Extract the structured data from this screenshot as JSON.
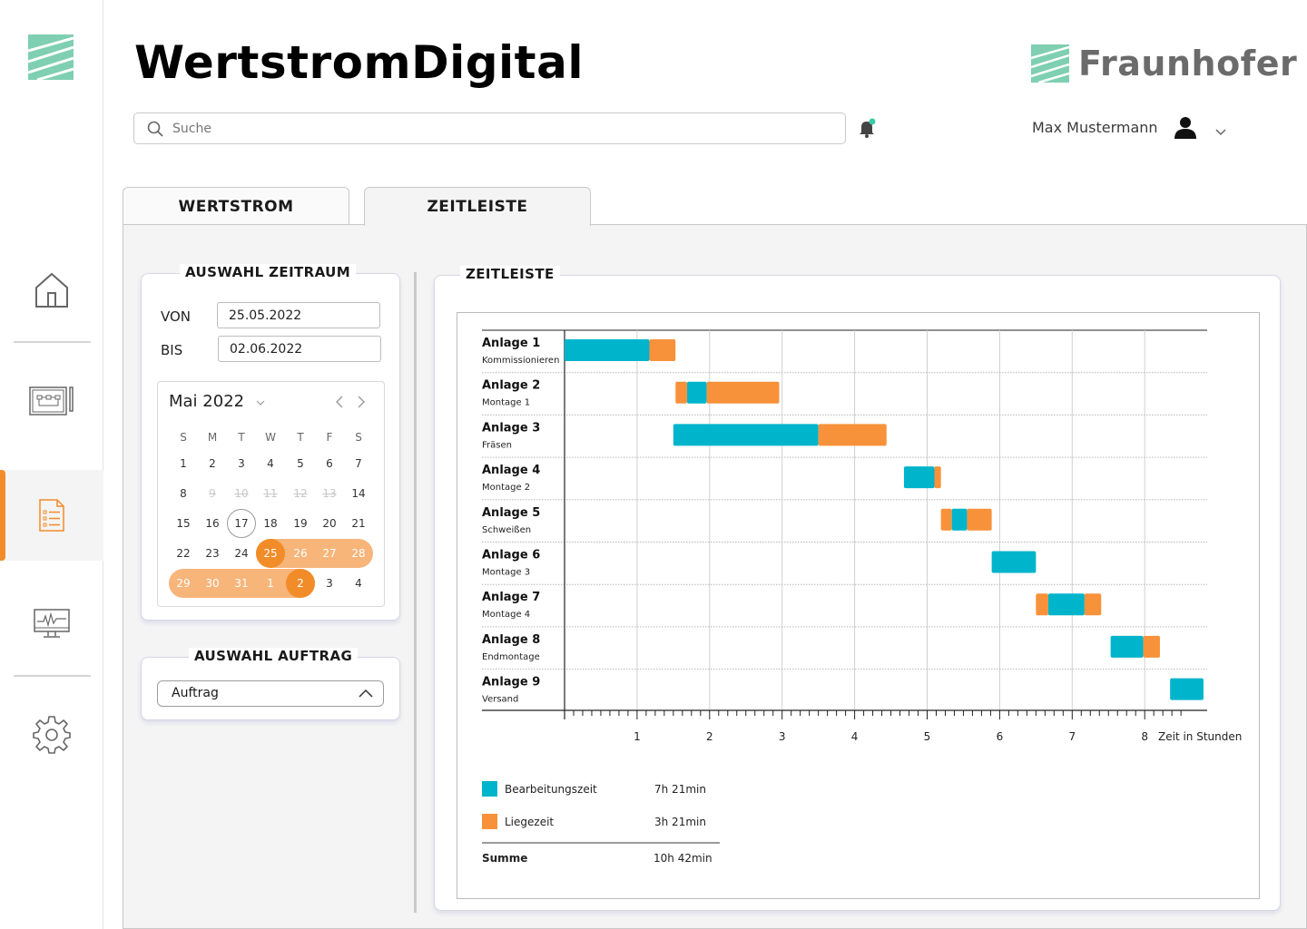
{
  "app": {
    "title": "WertstromDigital",
    "brand": "Fraunhofer"
  },
  "header": {
    "search_placeholder": "Suche",
    "username": "Max Mustermann"
  },
  "tabs": [
    {
      "label": "WERTSTROM"
    },
    {
      "label": "ZEITLEISTE"
    }
  ],
  "zeitraum": {
    "title": "AUSWAHL ZEITRAUM",
    "von_label": "VON",
    "von_value": "25.05.2022",
    "bis_label": "BIS",
    "bis_value": "02.06.2022",
    "calendar": {
      "month": "Mai 2022",
      "weekdays": [
        "S",
        "M",
        "T",
        "W",
        "T",
        "F",
        "S"
      ],
      "weeks": [
        [
          "1",
          "2",
          "3",
          "4",
          "5",
          "6",
          "7"
        ],
        [
          "8",
          "9",
          "10",
          "11",
          "12",
          "13",
          "14"
        ],
        [
          "15",
          "16",
          "17",
          "18",
          "19",
          "20",
          "21"
        ],
        [
          "22",
          "23",
          "24",
          "25",
          "26",
          "27",
          "28"
        ],
        [
          "29",
          "30",
          "31",
          "1",
          "2",
          "3",
          "4"
        ]
      ],
      "disabled": [
        "9",
        "10",
        "11",
        "12",
        "13"
      ],
      "today": "17",
      "range_start": "25",
      "range_end": "2"
    }
  },
  "auftrag": {
    "title": "AUSWAHL AUFTRAG",
    "value": "Auftrag"
  },
  "zeitleiste": {
    "title": "ZEITLEISTE",
    "summary": {
      "bearbeitung_label": "Bearbeitungszeit",
      "bearbeitung_value": "7h 21min",
      "liege_label": "Liegezeit",
      "liege_value": "3h 21min",
      "summe_label": "Summe",
      "summe_value": "10h 42min"
    }
  },
  "colors": {
    "accent": "#f28c28",
    "bearbeitung": "#00b4cc",
    "liege": "#f7923a",
    "brand_green": "#7fcfb2"
  },
  "chart_data": {
    "type": "bar",
    "orientation": "horizontal-gantt",
    "xlabel": "Zeit in Stunden",
    "xlim": [
      0,
      8.5
    ],
    "xticks": [
      1,
      2,
      3,
      4,
      5,
      6,
      7,
      8
    ],
    "grid": true,
    "rows": [
      {
        "name": "Anlage 1",
        "sub": "Kommissionieren",
        "segments": [
          {
            "type": "bearbeitung",
            "start": 0.0,
            "end": 1.17
          },
          {
            "type": "liege",
            "start": 1.17,
            "end": 1.53
          }
        ]
      },
      {
        "name": "Anlage 2",
        "sub": "Montage 1",
        "segments": [
          {
            "type": "liege",
            "start": 1.53,
            "end": 1.69
          },
          {
            "type": "bearbeitung",
            "start": 1.69,
            "end": 1.96
          },
          {
            "type": "liege",
            "start": 1.96,
            "end": 2.96
          }
        ]
      },
      {
        "name": "Anlage 3",
        "sub": "Fräsen",
        "segments": [
          {
            "type": "bearbeitung",
            "start": 1.5,
            "end": 3.5
          },
          {
            "type": "liege",
            "start": 3.5,
            "end": 4.44
          }
        ]
      },
      {
        "name": "Anlage 4",
        "sub": "Montage 2",
        "segments": [
          {
            "type": "bearbeitung",
            "start": 4.68,
            "end": 5.1
          },
          {
            "type": "liege",
            "start": 5.1,
            "end": 5.19
          }
        ]
      },
      {
        "name": "Anlage 5",
        "sub": "Schweißen",
        "segments": [
          {
            "type": "liege",
            "start": 5.19,
            "end": 5.34
          },
          {
            "type": "bearbeitung",
            "start": 5.34,
            "end": 5.55
          },
          {
            "type": "liege",
            "start": 5.55,
            "end": 5.89
          }
        ]
      },
      {
        "name": "Anlage 6",
        "sub": "Montage 3",
        "segments": [
          {
            "type": "bearbeitung",
            "start": 5.89,
            "end": 6.5
          }
        ]
      },
      {
        "name": "Anlage 7",
        "sub": "Montage 4",
        "segments": [
          {
            "type": "liege",
            "start": 6.5,
            "end": 6.67
          },
          {
            "type": "bearbeitung",
            "start": 6.67,
            "end": 7.17
          },
          {
            "type": "liege",
            "start": 7.17,
            "end": 7.4
          }
        ]
      },
      {
        "name": "Anlage 8",
        "sub": "Endmontage",
        "segments": [
          {
            "type": "bearbeitung",
            "start": 7.53,
            "end": 7.98
          },
          {
            "type": "liege",
            "start": 7.98,
            "end": 8.21
          }
        ]
      },
      {
        "name": "Anlage 9",
        "sub": "Versand",
        "segments": [
          {
            "type": "bearbeitung",
            "start": 8.35,
            "end": 8.81
          }
        ]
      }
    ],
    "legend": [
      {
        "name": "Bearbeitungszeit",
        "color": "#00b4cc"
      },
      {
        "name": "Liegezeit",
        "color": "#f7923a"
      }
    ]
  }
}
